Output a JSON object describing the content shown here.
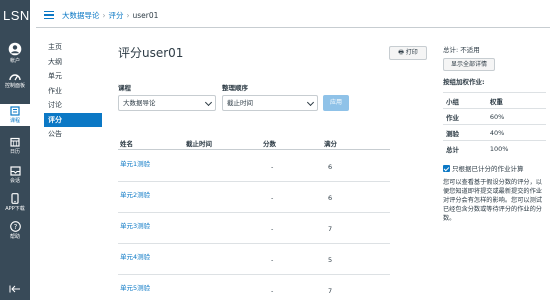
{
  "global_nav": {
    "logo": "LSN",
    "items": [
      {
        "label": "帐户",
        "icon": "account-icon"
      },
      {
        "label": "控制面板",
        "icon": "dashboard-icon"
      },
      {
        "label": "课程",
        "icon": "courses-icon"
      },
      {
        "label": "日历",
        "icon": "calendar-icon"
      },
      {
        "label": "会话",
        "icon": "inbox-icon"
      },
      {
        "label": "APP下载",
        "icon": "phone-icon"
      },
      {
        "label": "帮助",
        "icon": "help-icon"
      }
    ],
    "collapse_icon": "collapse-arrow-icon"
  },
  "breadcrumb": [
    "大数据导论",
    "评分",
    "user01"
  ],
  "course_nav": [
    "主页",
    "大纲",
    "单元",
    "作业",
    "讨论",
    "评分",
    "公告"
  ],
  "main": {
    "title": "评分user01",
    "print_label": "打印",
    "course_label": "课程",
    "course_value": "大数据导论",
    "sort_label": "整理顺序",
    "sort_value": "截止时间",
    "apply_label": "应用",
    "headers": [
      "姓名",
      "截止时间",
      "分数",
      "满分"
    ],
    "rows": [
      {
        "name": "单元1测验",
        "due": "",
        "score": "-",
        "points": "6"
      },
      {
        "name": "单元2测验",
        "due": "",
        "score": "-",
        "points": "6"
      },
      {
        "name": "单元3测验",
        "due": "",
        "score": "-",
        "points": "7"
      },
      {
        "name": "单元4测验",
        "due": "",
        "score": "-",
        "points": "5"
      },
      {
        "name": "单元5测验",
        "due": "",
        "score": "-",
        "points": "7"
      }
    ]
  },
  "right": {
    "total": "总计: 不适用",
    "show_all": "显示全部详情",
    "weight_title": "按组加权作业:",
    "weight_headers": [
      "小组",
      "权重"
    ],
    "weights": [
      {
        "group": "作业",
        "weight": "60%"
      },
      {
        "group": "测验",
        "weight": "40%"
      },
      {
        "group": "总计",
        "weight": "100%"
      }
    ],
    "checkbox_label": "只根据已计分的作业计算",
    "note": "您可以查看基于假设分数的评分，以便您知道即将提交或最新提交的作业对评分会有怎样的影响。您可以测试已经包含分数或等待评分的作业的分数。"
  },
  "colors": {
    "accent": "#0b78c5",
    "nav_bg": "#384a58"
  }
}
